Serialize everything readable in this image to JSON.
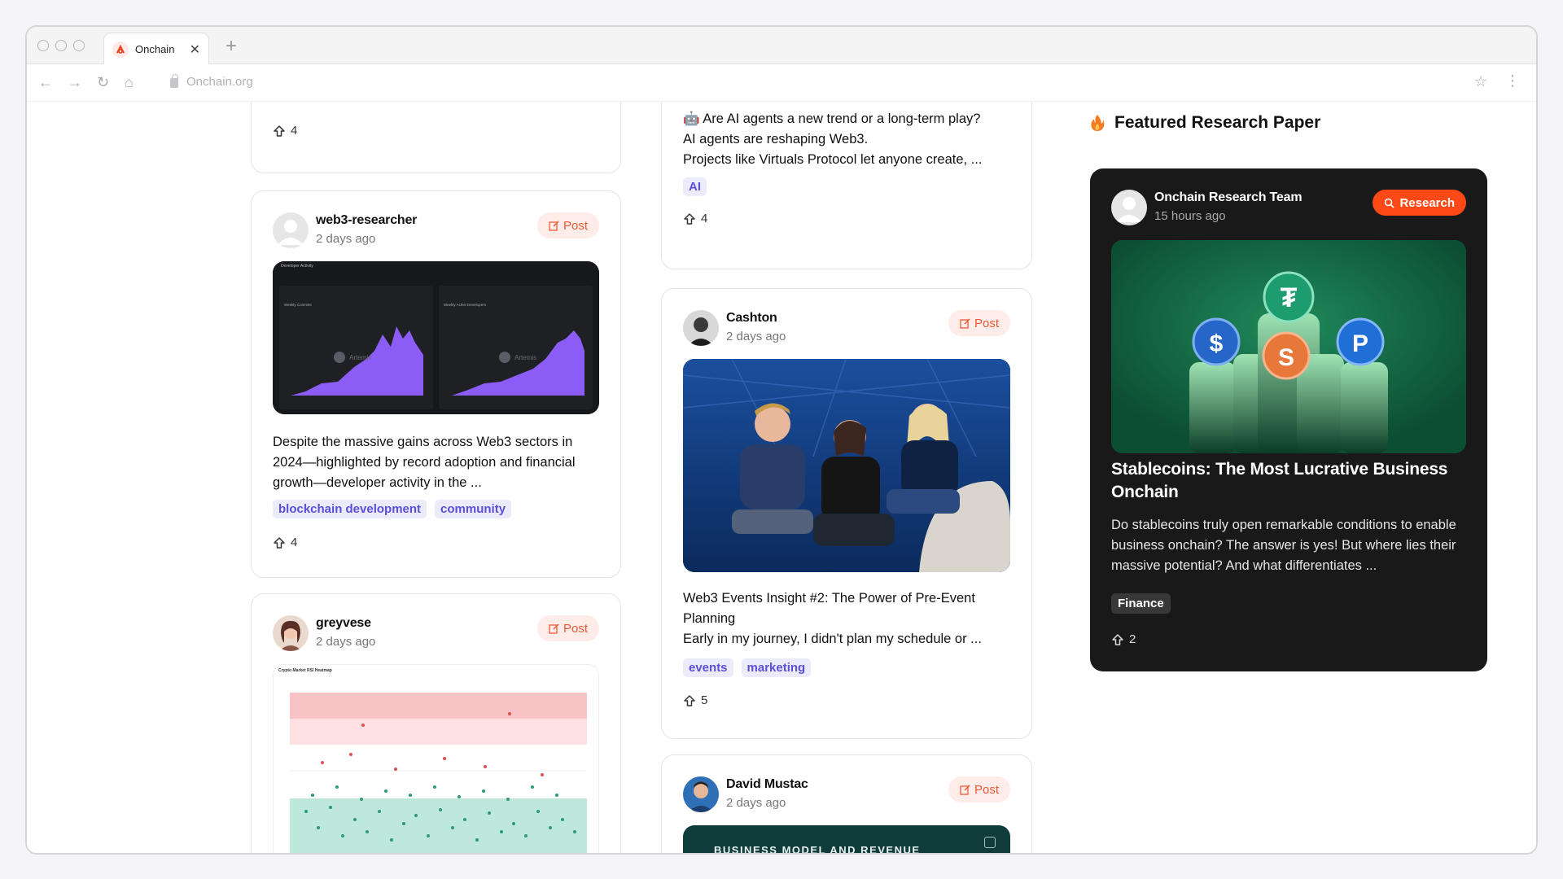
{
  "browser": {
    "tab_title": "Onchain",
    "url": "Onchain.org",
    "new_tab": "+",
    "close": "✕"
  },
  "feed": {
    "top_left_card": {
      "upvotes": "4"
    },
    "ai_card": {
      "emoji": "🤖",
      "text_line1": "Are AI agents a new trend or a long-term play?",
      "text_line2": "AI agents are reshaping Web3.",
      "text_line3": "Projects like Virtuals Protocol let anyone create, ...",
      "tags": [
        "AI"
      ],
      "upvotes": "4"
    },
    "researcher_card": {
      "author": "web3-researcher",
      "time": "2 days ago",
      "badge": "Post",
      "text": "Despite the massive gains across Web3 sectors in 2024—highlighted by record adoption and financial growth—developer activity in the ...",
      "tags": [
        "blockchain development",
        "community"
      ],
      "upvotes": "4",
      "chart_left_title": "Weekly Commits",
      "chart_right_title": "Weekly Active Developers",
      "chart_header": "Developer Activity",
      "watermark": "Artemis"
    },
    "cashton_card": {
      "author": "Cashton",
      "time": "2 days ago",
      "badge": "Post",
      "text_line1": "Web3 Events Insight #2: The Power of Pre-Event Planning",
      "text_line2": "Early in my journey, I didn't plan my schedule or ...",
      "tags": [
        "events",
        "marketing"
      ],
      "upvotes": "5"
    },
    "greyvese_card": {
      "author": "greyvese",
      "time": "2 days ago",
      "badge": "Post",
      "chart_title": "Crypto Market RSI Heatmap"
    },
    "david_card": {
      "author": "David Mustac",
      "time": "2 days ago",
      "badge": "Post",
      "banner_text": "BUSINESS MODEL AND REVENUE"
    }
  },
  "featured": {
    "heading": "Featured Research Paper",
    "author": "Onchain Research Team",
    "time": "15 hours ago",
    "badge": "Research",
    "title": "Stablecoins: The Most Lucrative Business Onchain",
    "text": "Do stablecoins truly open remarkable conditions to enable business onchain? The answer is yes! But where lies their massive potential? And what differentiates ...",
    "tag": "Finance",
    "upvotes": "2"
  },
  "colors": {
    "accent": "#ff4a17",
    "tag_bg": "#ecebfb",
    "tag_text": "#5a4fd8",
    "dark_card": "#191919"
  }
}
